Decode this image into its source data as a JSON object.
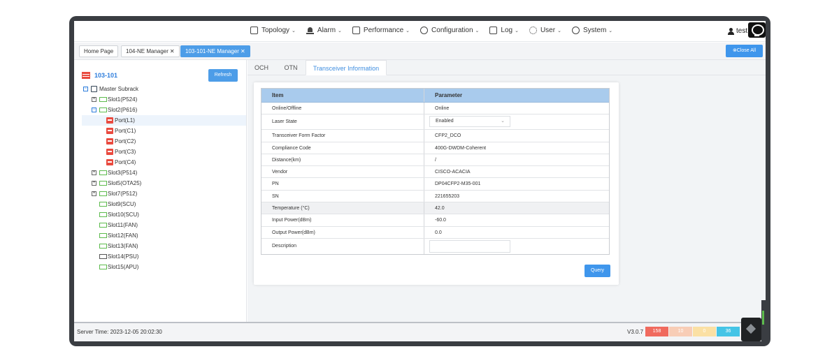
{
  "nav": {
    "menu": [
      {
        "label": "Topology",
        "icon": "topology-icon"
      },
      {
        "label": "Alarm",
        "icon": "alarm-bell-icon"
      },
      {
        "label": "Performance",
        "icon": "performance-icon"
      },
      {
        "label": "Configuration",
        "icon": "configuration-icon"
      },
      {
        "label": "Log",
        "icon": "log-icon"
      },
      {
        "label": "User",
        "icon": "user-group-icon"
      },
      {
        "label": "System",
        "icon": "system-icon"
      }
    ],
    "caret": "⌄",
    "username": "test"
  },
  "tabs": [
    {
      "label": "Home Page",
      "close": ""
    },
    {
      "label": "104-NE Manager",
      "close": "✕"
    },
    {
      "label": "103-101-NE Manager",
      "close": "✕"
    }
  ],
  "close_all_label": "⊗Close All",
  "sidebar": {
    "ne_name": "103-101",
    "refresh_label": "Refresh",
    "subrack": "Master Subrack",
    "slots": [
      {
        "label": "Slot1(P524)",
        "toggle": "+"
      },
      {
        "label": "Slot2(P616)",
        "toggle": "−"
      },
      {
        "label": "Slot3(P514)",
        "toggle": "+"
      },
      {
        "label": "Slot5(OTA25)",
        "toggle": "+"
      },
      {
        "label": "Slot7(P512)",
        "toggle": "+"
      },
      {
        "label": "Slot9(SCU)",
        "toggle": ""
      },
      {
        "label": "Slot10(SCU)",
        "toggle": ""
      },
      {
        "label": "Slot11(FAN)",
        "toggle": ""
      },
      {
        "label": "Slot12(FAN)",
        "toggle": ""
      },
      {
        "label": "Slot13(FAN)",
        "toggle": ""
      },
      {
        "label": "Slot14(PSU)",
        "toggle": ""
      },
      {
        "label": "Slot15(APU)",
        "toggle": ""
      }
    ],
    "ports": [
      "Port(L1)",
      "Port(C1)",
      "Port(C2)",
      "Port(C3)",
      "Port(C4)"
    ],
    "selected_port": "Port(L1)"
  },
  "content_tabs": [
    "OCH",
    "OTN",
    "Transceiver Information"
  ],
  "active_content_tab": "Transceiver Information",
  "table": {
    "headers": [
      "Item",
      "Parameter"
    ],
    "rows": [
      {
        "item": "Online/Offline",
        "value": "Online"
      },
      {
        "item": "Laser State",
        "value": "Enabled"
      },
      {
        "item": "Transceiver Form Factor",
        "value": "CFP2_DCO"
      },
      {
        "item": "Compliance Code",
        "value": "400G-DWDM-Coherent"
      },
      {
        "item": "Distance(km)",
        "value": "/"
      },
      {
        "item": "Vendor",
        "value": "CISCO-ACACIA"
      },
      {
        "item": "PN",
        "value": "DP04CFP2-M35-001"
      },
      {
        "item": "SN",
        "value": "221655203"
      },
      {
        "item": "Temperature (°C)",
        "value": "42.0"
      },
      {
        "item": "Input Power(dBm)",
        "value": "-60.0"
      },
      {
        "item": "Output Power(dBm)",
        "value": "0.0"
      },
      {
        "item": "Description",
        "value": ""
      }
    ]
  },
  "query_label": "Query",
  "status": {
    "server_time": "Server Time:  2023-12-05 20:02:30",
    "version": "V3.0.7",
    "counters": [
      {
        "value": "158",
        "color": "#f06a5e"
      },
      {
        "value": "10",
        "color": "#f8cdb6"
      },
      {
        "value": "0",
        "color": "#fbe0a4"
      },
      {
        "value": "36",
        "color": "#45c4e6"
      }
    ]
  }
}
